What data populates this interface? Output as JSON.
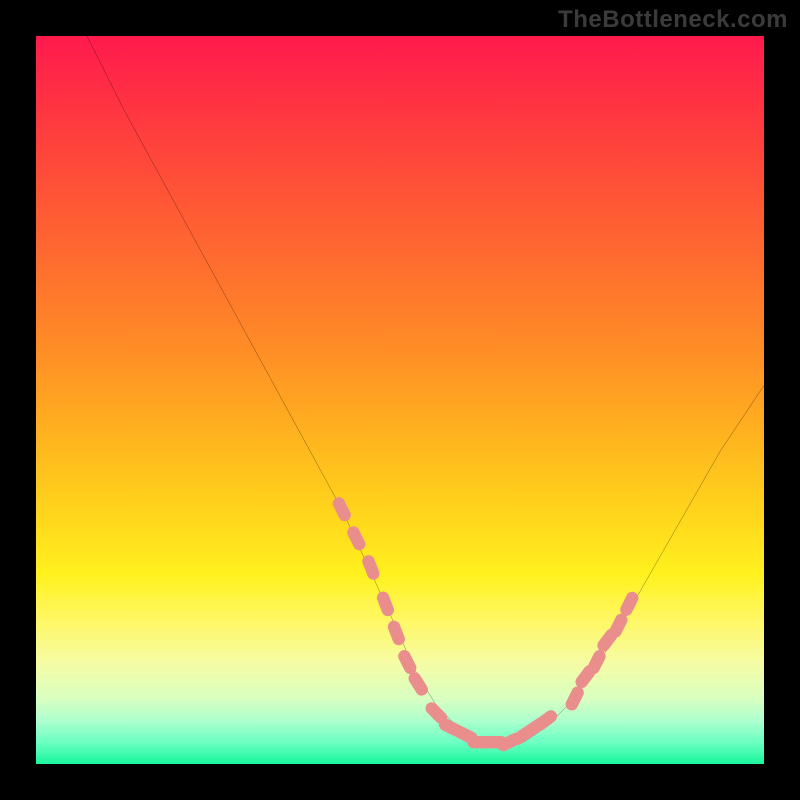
{
  "watermark": "TheBottleneck.com",
  "chart_data": {
    "type": "line",
    "title": "",
    "xlabel": "",
    "ylabel": "",
    "xlim": [
      0,
      100
    ],
    "ylim": [
      0,
      100
    ],
    "grid": false,
    "legend": false,
    "series": [
      {
        "name": "bottleneck-curve",
        "x": [
          7,
          12,
          18,
          24,
          30,
          36,
          42,
          48,
          52,
          55,
          58,
          61,
          64,
          67,
          70,
          74,
          78,
          82,
          86,
          90,
          94,
          98,
          100
        ],
        "y": [
          100,
          90,
          79,
          68,
          57,
          46,
          35,
          22,
          13,
          8,
          5,
          3,
          3,
          3,
          5,
          9,
          15,
          22,
          29,
          36,
          43,
          49,
          52
        ]
      }
    ],
    "highlight_points": {
      "name": "dotted-segments",
      "color": "#e98e8c",
      "points": [
        {
          "x": 42,
          "y": 35
        },
        {
          "x": 44,
          "y": 31
        },
        {
          "x": 46,
          "y": 27
        },
        {
          "x": 48,
          "y": 22
        },
        {
          "x": 49.5,
          "y": 18
        },
        {
          "x": 51,
          "y": 14
        },
        {
          "x": 52.5,
          "y": 11
        },
        {
          "x": 55,
          "y": 7
        },
        {
          "x": 57,
          "y": 5
        },
        {
          "x": 59,
          "y": 4
        },
        {
          "x": 61,
          "y": 3
        },
        {
          "x": 63,
          "y": 3
        },
        {
          "x": 65,
          "y": 3
        },
        {
          "x": 67,
          "y": 4
        },
        {
          "x": 68.5,
          "y": 5
        },
        {
          "x": 70,
          "y": 6
        },
        {
          "x": 74,
          "y": 9
        },
        {
          "x": 75.5,
          "y": 12
        },
        {
          "x": 77,
          "y": 14
        },
        {
          "x": 78.5,
          "y": 17
        },
        {
          "x": 80,
          "y": 19
        },
        {
          "x": 81.5,
          "y": 22
        }
      ]
    },
    "gradient_stops": [
      {
        "pos": 0,
        "color": "#ff1a4d"
      },
      {
        "pos": 22,
        "color": "#ff5536"
      },
      {
        "pos": 50,
        "color": "#ffa321"
      },
      {
        "pos": 74,
        "color": "#fff11e"
      },
      {
        "pos": 91,
        "color": "#d8ffc0"
      },
      {
        "pos": 100,
        "color": "#16f79a"
      }
    ]
  }
}
